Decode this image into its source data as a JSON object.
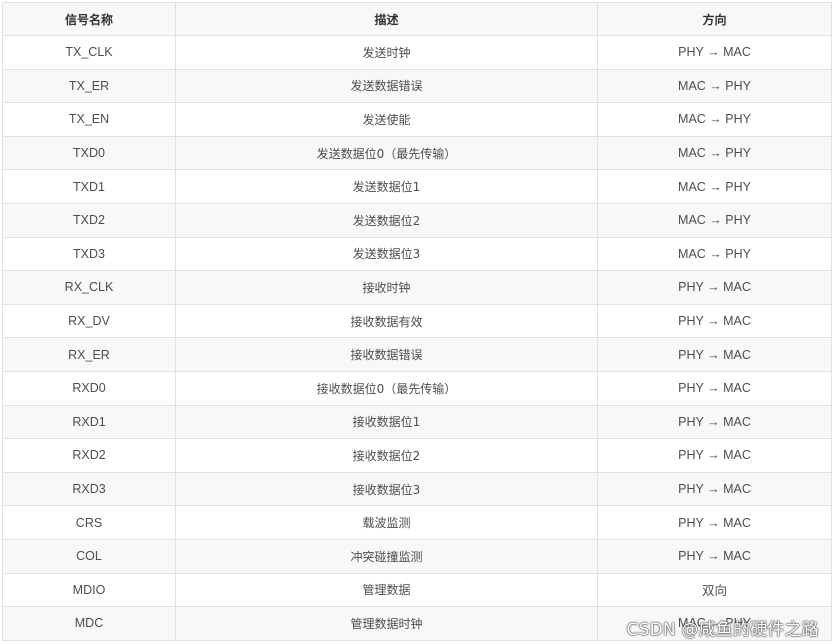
{
  "table": {
    "headers": [
      "信号名称",
      "描述",
      "方向"
    ],
    "rows": [
      {
        "name": "TX_CLK",
        "desc": "发送时钟",
        "dir": "PHY → MAC"
      },
      {
        "name": "TX_ER",
        "desc": "发送数据错误",
        "dir": "MAC → PHY"
      },
      {
        "name": "TX_EN",
        "desc": "发送使能",
        "dir": "MAC → PHY"
      },
      {
        "name": "TXD0",
        "desc": "发送数据位0（最先传输）",
        "dir": "MAC → PHY"
      },
      {
        "name": "TXD1",
        "desc": "发送数据位1",
        "dir": "MAC → PHY"
      },
      {
        "name": "TXD2",
        "desc": "发送数据位2",
        "dir": "MAC → PHY"
      },
      {
        "name": "TXD3",
        "desc": "发送数据位3",
        "dir": "MAC → PHY"
      },
      {
        "name": "RX_CLK",
        "desc": "接收时钟",
        "dir": "PHY → MAC"
      },
      {
        "name": "RX_DV",
        "desc": "接收数据有效",
        "dir": "PHY → MAC"
      },
      {
        "name": "RX_ER",
        "desc": "接收数据错误",
        "dir": "PHY → MAC"
      },
      {
        "name": "RXD0",
        "desc": "接收数据位0（最先传输）",
        "dir": "PHY → MAC"
      },
      {
        "name": "RXD1",
        "desc": "接收数据位1",
        "dir": "PHY → MAC"
      },
      {
        "name": "RXD2",
        "desc": "接收数据位2",
        "dir": "PHY → MAC"
      },
      {
        "name": "RXD3",
        "desc": "接收数据位3",
        "dir": "PHY → MAC"
      },
      {
        "name": "CRS",
        "desc": "载波监测",
        "dir": "PHY → MAC"
      },
      {
        "name": "COL",
        "desc": "冲突碰撞监测",
        "dir": "PHY → MAC"
      },
      {
        "name": "MDIO",
        "desc": "管理数据",
        "dir": "双向"
      },
      {
        "name": "MDC",
        "desc": "管理数据时钟",
        "dir": "MAC → PHY"
      }
    ]
  },
  "watermark": "CSDN @咸鱼的硬件之路"
}
